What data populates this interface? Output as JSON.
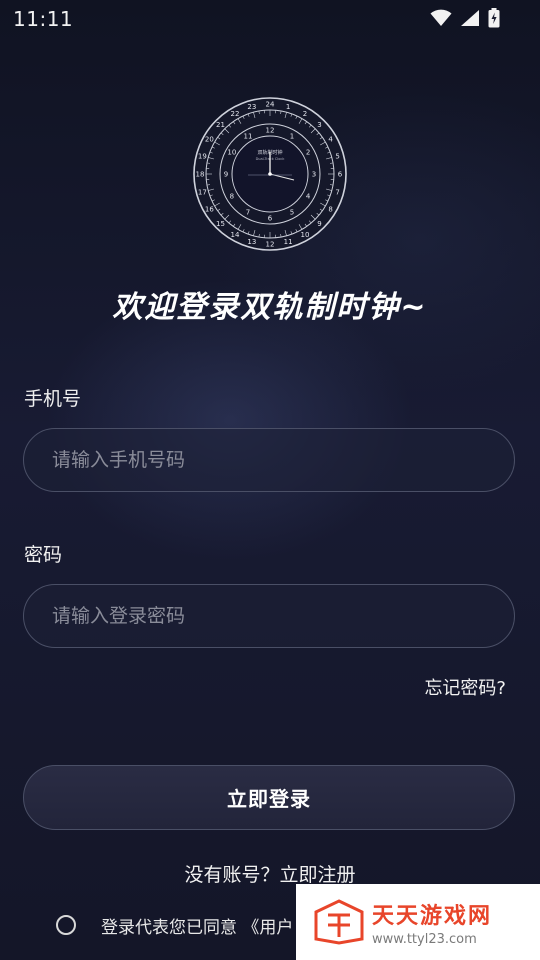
{
  "status_bar": {
    "time": "11:11",
    "icons": [
      "wifi-icon",
      "signal-icon",
      "battery-charging-icon"
    ]
  },
  "logo": {
    "icon": "dual-track-clock-logo",
    "outer_numbers": [
      "1",
      "2",
      "3",
      "4",
      "5",
      "6",
      "7",
      "8",
      "9",
      "10",
      "11",
      "12",
      "13",
      "14",
      "15",
      "16",
      "17",
      "18",
      "19",
      "20",
      "21",
      "22",
      "23",
      "24"
    ],
    "inner_numbers": [
      "12",
      "1",
      "2",
      "3",
      "4",
      "5",
      "6",
      "7",
      "8",
      "9",
      "10",
      "11"
    ],
    "small_text": "双轨制时钟",
    "tiny_text": "Dual-Track Clock"
  },
  "welcome": "欢迎登录双轨制时钟~",
  "phone": {
    "label": "手机号",
    "placeholder": "请输入手机号码"
  },
  "password": {
    "label": "密码",
    "placeholder": "请输入登录密码"
  },
  "forgot": "忘记密码?",
  "login_button": "立即登录",
  "register": "没有账号？立即注册",
  "agreement": "登录代表您已同意 《用户",
  "watermark": {
    "title": "天天游戏网",
    "url": "www.ttyl23.com"
  },
  "colors": {
    "background": "#14172b",
    "field_border": "#4a4f66",
    "placeholder": "#8a8c99",
    "watermark_brand": "#e8452a"
  }
}
